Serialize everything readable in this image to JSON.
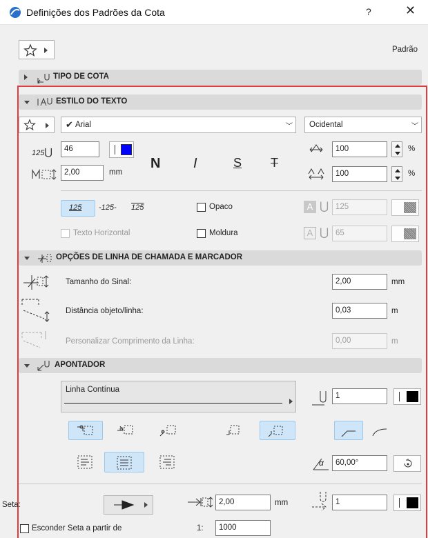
{
  "window": {
    "title": "Definições dos Padrões da Cota",
    "help_label": "?",
    "close_label": "✕"
  },
  "header": {
    "favorites_icon": "star-icon",
    "preset_label": "Padrão"
  },
  "sections": {
    "tipo_cota": "TIPO DE COTA",
    "estilo_texto": "ESTILO DO TEXTO",
    "linha_chamada": "OPÇÕES DE LINHA DE CHAMADA E MARCADOR",
    "apontador": "APONTADOR"
  },
  "text_style": {
    "font": "Arial",
    "script": "Ocidental",
    "size": "46",
    "spacing": "2,00",
    "spacing_unit": "mm",
    "bold_label": "N",
    "italic_label": "I",
    "underline_label": "S",
    "strike_label": "T",
    "width_factor": "100",
    "char_spacing": "100",
    "percent": "%",
    "number_format_1": "125",
    "number_format_2": "-125-",
    "number_format_3": "125",
    "opaque_label": "Opaco",
    "opaque_pen": "125",
    "frame_label": "Moldura",
    "frame_pen": "65",
    "horizontal_label": "Texto Horizontal",
    "letter_a": "A",
    "color_accent": "#0000ff"
  },
  "leader": {
    "size_label": "Tamanho do Sinal:",
    "size_value": "2,00",
    "size_unit": "mm",
    "distance_label": "Distância objeto/linha:",
    "distance_value": "0,03",
    "distance_unit": "m",
    "custom_label": "Personalizar Comprimento da Linha:",
    "custom_value": "0,00",
    "custom_unit": "m"
  },
  "pointer": {
    "line_type": "Linha Contínua",
    "pen": "1",
    "angle": "60,00°",
    "alpha": "α",
    "arrow_label": "Seta:",
    "arrow_size": "2,00",
    "arrow_unit": "mm",
    "arrow_pen": "1",
    "hide_label": "Esconder Seta a partir de",
    "scale_prefix": "1:",
    "scale_value": "1000"
  }
}
